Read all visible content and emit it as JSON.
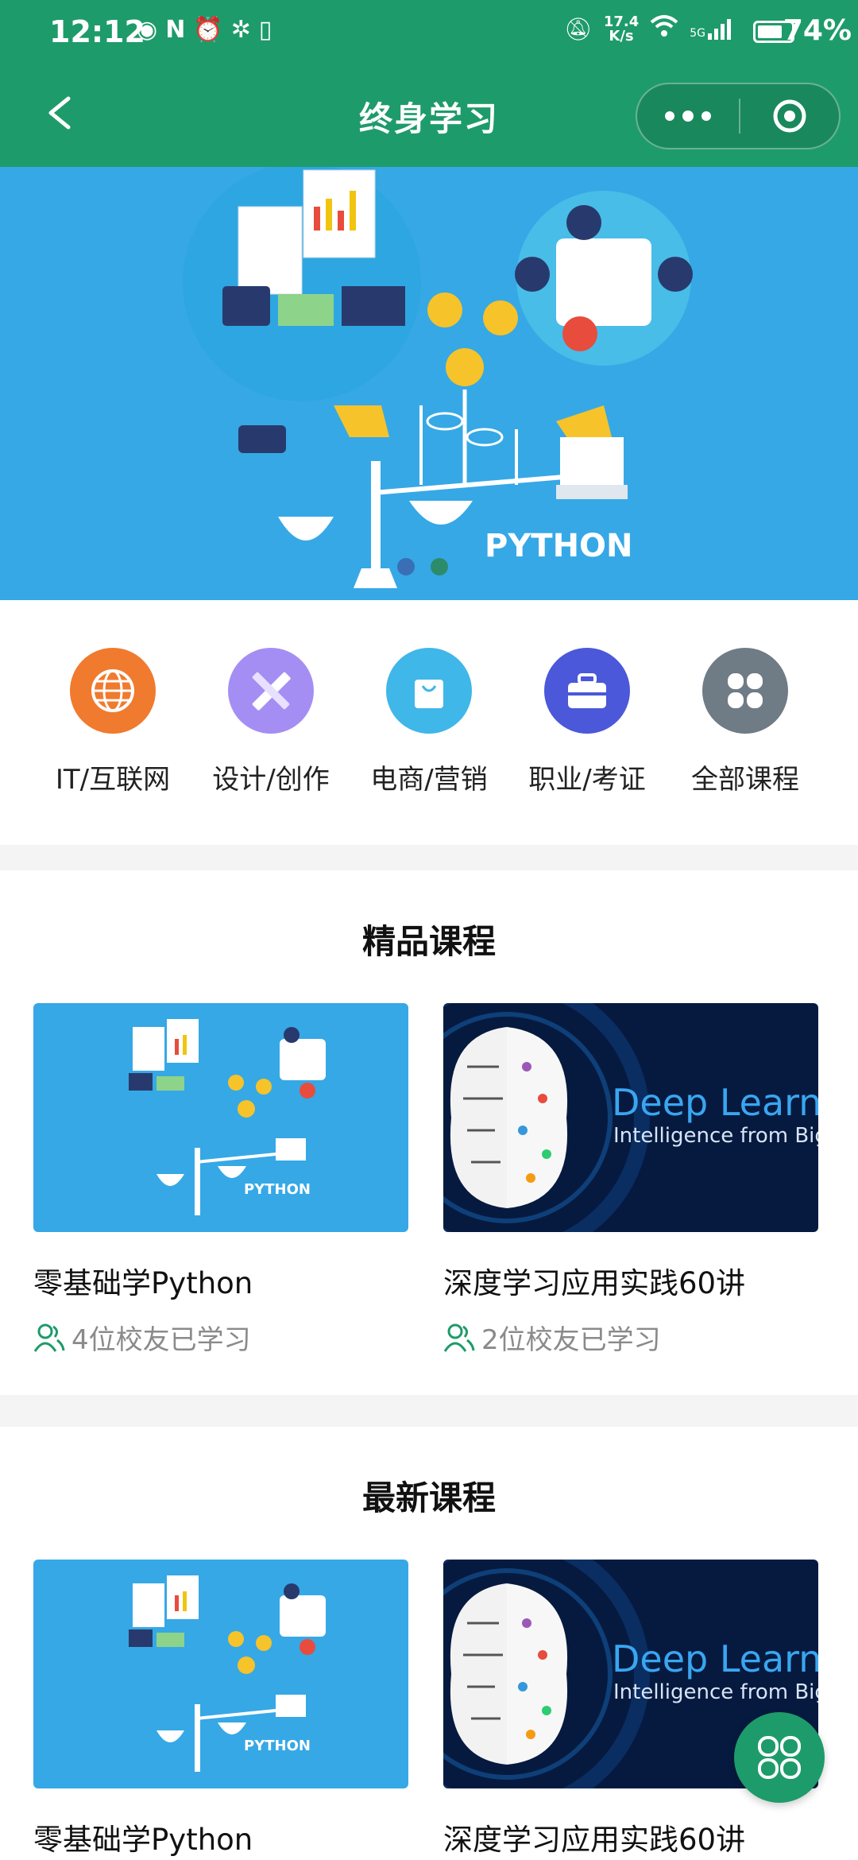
{
  "status_bar": {
    "time": "12:12",
    "net_speed_value": "17.4",
    "net_speed_unit": "K/s",
    "signal_label": "5G",
    "battery": "74%",
    "battery_level": 0.74
  },
  "nav": {
    "title": "终身学习"
  },
  "banner": {
    "text": "PYTHON",
    "slides": 2,
    "active_slide": 1
  },
  "categories": [
    {
      "label": "IT/互联网",
      "color": "#f07a2e",
      "icon": "globe-icon"
    },
    {
      "label": "设计/创作",
      "color": "#a58ef3",
      "icon": "pencil-ruler-icon"
    },
    {
      "label": "电商/营销",
      "color": "#3fb7e8",
      "icon": "shopping-bag-icon"
    },
    {
      "label": "职业/考证",
      "color": "#4a58d9",
      "icon": "briefcase-icon"
    },
    {
      "label": "全部课程",
      "color": "#6f7b85",
      "icon": "grid-icon"
    }
  ],
  "featured": {
    "heading": "精品课程",
    "courses": [
      {
        "name": "零基础学Python",
        "learners": "4位校友已学习",
        "thumb_text": "PYTHON"
      },
      {
        "name": "深度学习应用实践60讲",
        "learners": "2位校友已学习",
        "thumb_title": "Deep Learni",
        "thumb_subtitle": "Intelligence from Big"
      }
    ]
  },
  "latest": {
    "heading": "最新课程",
    "courses": [
      {
        "name": "零基础学Python",
        "thumb_text": "PYTHON"
      },
      {
        "name": "深度学习应用实践60讲",
        "thumb_title": "Deep Learni",
        "thumb_subtitle": "Intelligence from Big"
      }
    ]
  },
  "colors": {
    "brand": "#1e9b6a",
    "banner_bg": "#36a8e6",
    "deep_bg": "#061a40"
  }
}
